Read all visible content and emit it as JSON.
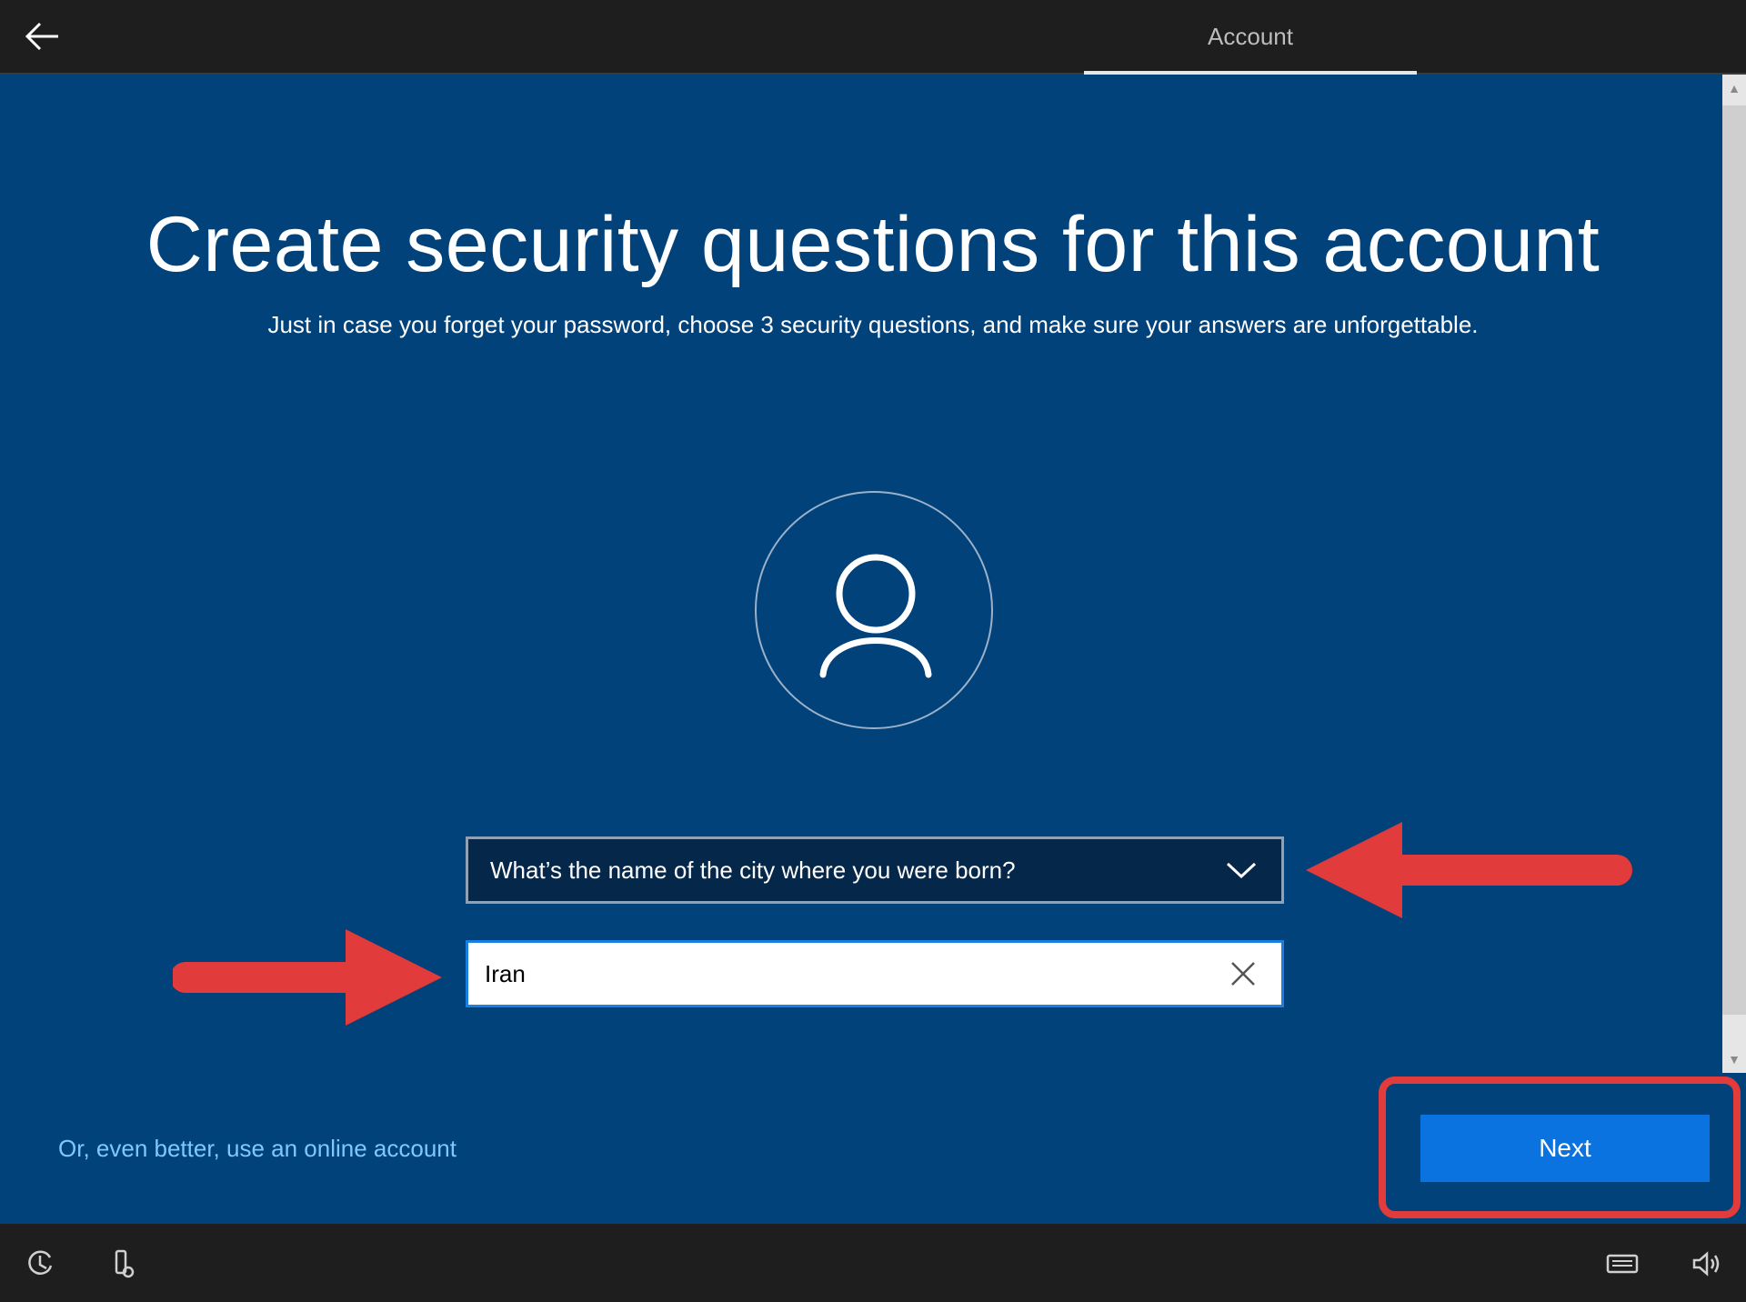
{
  "header": {
    "back_icon": "back-arrow-icon",
    "tab_label": "Account"
  },
  "main": {
    "title": "Create security questions for this account",
    "subtitle": "Just in case you forget your password, choose 3 security questions, and make sure your answers are unforgettable.",
    "avatar_icon": "user-icon",
    "question": {
      "selected": "What’s the name of the city where you were born?",
      "icon": "chevron-down-icon"
    },
    "answer": {
      "value": "Iran",
      "clear_icon": "close-icon"
    },
    "online_account_link": "Or, even better, use an online account",
    "next_label": "Next"
  },
  "annotations": {
    "arrow_color": "#e23b3b",
    "highlight_color": "#e23b3b"
  },
  "taskbar": {
    "left_icons": [
      "ease-of-access-icon",
      "accessibility-device-icon"
    ],
    "right_icons": [
      "keyboard-icon",
      "volume-icon"
    ]
  },
  "colors": {
    "background": "#02427a",
    "bar": "#1e1e1e",
    "accent": "#0a73e0",
    "link": "#7ec8ff"
  }
}
